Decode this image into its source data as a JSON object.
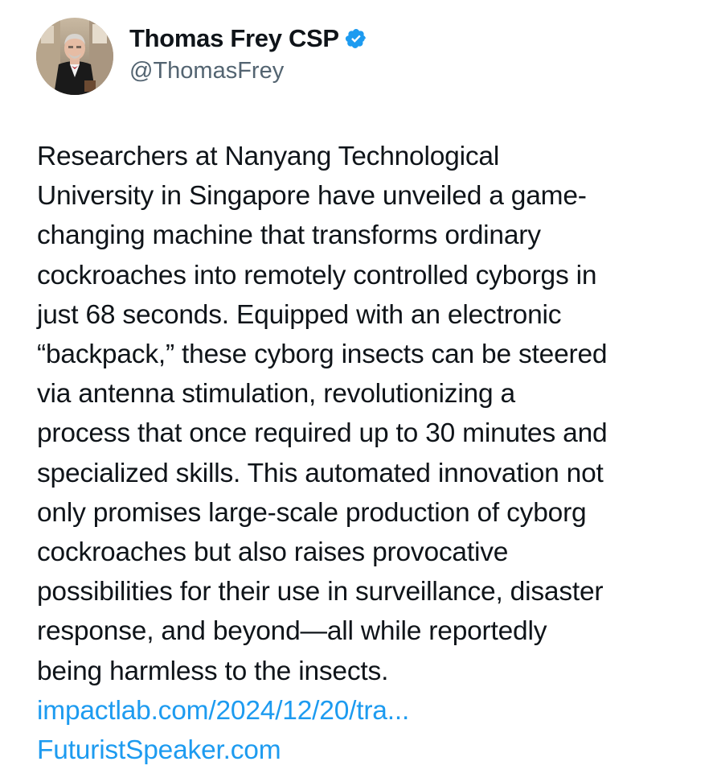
{
  "author": {
    "display_name": "Thomas Frey CSP",
    "handle": "@ThomasFrey",
    "verified_icon": "verified-badge-icon",
    "verified_color": "#1d9bf0"
  },
  "tweet": {
    "text": "Researchers at Nanyang Technological\nUniversity in Singapore have unveiled a game-\nchanging machine that transforms ordinary\ncockroaches into remotely controlled cyborgs in\njust 68 seconds. Equipped with an electronic\n“backpack,” these cyborg insects can be steered\nvia antenna stimulation, revolutionizing a\nprocess that once required up to 30 minutes and\nspecialized skills. This automated innovation not\nonly promises large-scale production of cyborg\ncockroaches but also raises provocative\npossibilities for their use in surveillance, disaster\nresponse, and beyond—all while reportedly\nbeing harmless to the insects.",
    "links": [
      {
        "text": "impactlab.com/2024/12/20/tra..."
      },
      {
        "text": "FuturistSpeaker.com"
      }
    ]
  },
  "colors": {
    "text": "#0f1419",
    "secondary": "#536471",
    "link": "#1d9bf0",
    "background": "#ffffff"
  }
}
